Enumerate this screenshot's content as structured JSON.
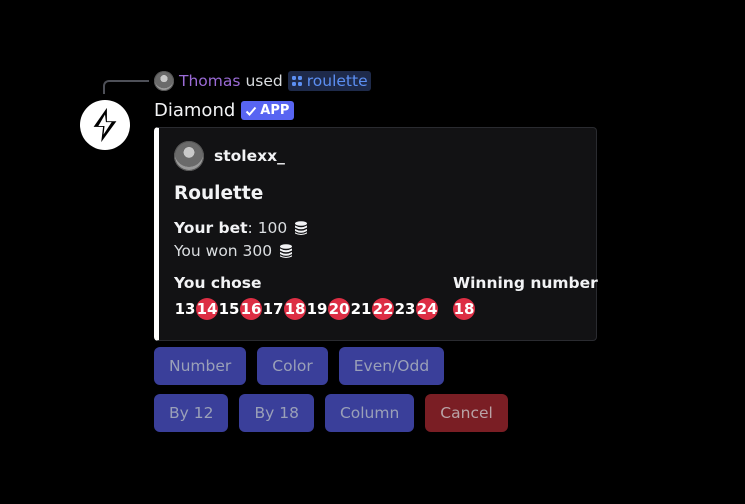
{
  "reply": {
    "user": "Thomas",
    "used_text": "used",
    "command": "roulette",
    "command_icon": "app-command-icon"
  },
  "bot": {
    "name": "Diamond",
    "badge": "APP",
    "avatar_icon": "diamond-sparkle-icon"
  },
  "embed": {
    "accent_color": "#ffffff",
    "author": "stolexx_",
    "title": "Roulette",
    "bet_label": "Your bet",
    "bet_value": ": 100",
    "won_text": "You won 300",
    "coin_icon": "coins-icon",
    "chose_label": "You chose",
    "chosen_numbers": [
      {
        "n": "13",
        "color": "black"
      },
      {
        "n": "14",
        "color": "red"
      },
      {
        "n": "15",
        "color": "black"
      },
      {
        "n": "16",
        "color": "red"
      },
      {
        "n": "17",
        "color": "black"
      },
      {
        "n": "18",
        "color": "red"
      },
      {
        "n": "19",
        "color": "black"
      },
      {
        "n": "20",
        "color": "red"
      },
      {
        "n": "21",
        "color": "black"
      },
      {
        "n": "22",
        "color": "red"
      },
      {
        "n": "23",
        "color": "black"
      },
      {
        "n": "24",
        "color": "red"
      }
    ],
    "winning_label": "Winning number",
    "winning_number": {
      "n": "18",
      "color": "red"
    }
  },
  "buttons": {
    "row1": [
      "Number",
      "Color",
      "Even/Odd"
    ],
    "row2": [
      "By 12",
      "By 18",
      "Column"
    ],
    "cancel": "Cancel"
  },
  "colors": {
    "button_primary": "#3a3f9a",
    "button_danger": "#7a1e24",
    "red_number": "#dd2e44",
    "reply_user": "#9b6bd6",
    "command_link": "#5c8ff2",
    "badge": "#5865f2"
  }
}
